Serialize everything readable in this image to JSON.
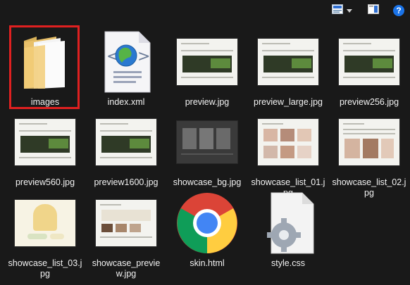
{
  "toolbar": {
    "view_mode_icon": "view-mode-icon",
    "pane_icon": "preview-pane-icon",
    "help_label": "?"
  },
  "files": [
    {
      "name": "images",
      "icon": "folder-icon"
    },
    {
      "name": "index.xml",
      "icon": "xml-file-icon"
    },
    {
      "name": "preview.jpg",
      "icon": "image-thumbnail"
    },
    {
      "name": "preview_large.jpg",
      "icon": "image-thumbnail"
    },
    {
      "name": "preview256.jpg",
      "icon": "image-thumbnail"
    },
    {
      "name": "preview560.jpg",
      "icon": "image-thumbnail"
    },
    {
      "name": "preview1600.jpg",
      "icon": "image-thumbnail"
    },
    {
      "name": "showcase_bg.jpg",
      "icon": "image-thumbnail"
    },
    {
      "name": "showcase_list_01.jpg",
      "icon": "image-thumbnail"
    },
    {
      "name": "showcase_list_02.jpg",
      "icon": "image-thumbnail"
    },
    {
      "name": "showcase_list_03.jpg",
      "icon": "image-thumbnail"
    },
    {
      "name": "showcase_preview.jpg",
      "icon": "image-thumbnail"
    },
    {
      "name": "skin.html",
      "icon": "chrome-icon"
    },
    {
      "name": "style.css",
      "icon": "css-file-icon"
    }
  ],
  "colors": {
    "background": "#191919",
    "selection_border": "#e02020",
    "help_blue": "#1a73e8"
  }
}
